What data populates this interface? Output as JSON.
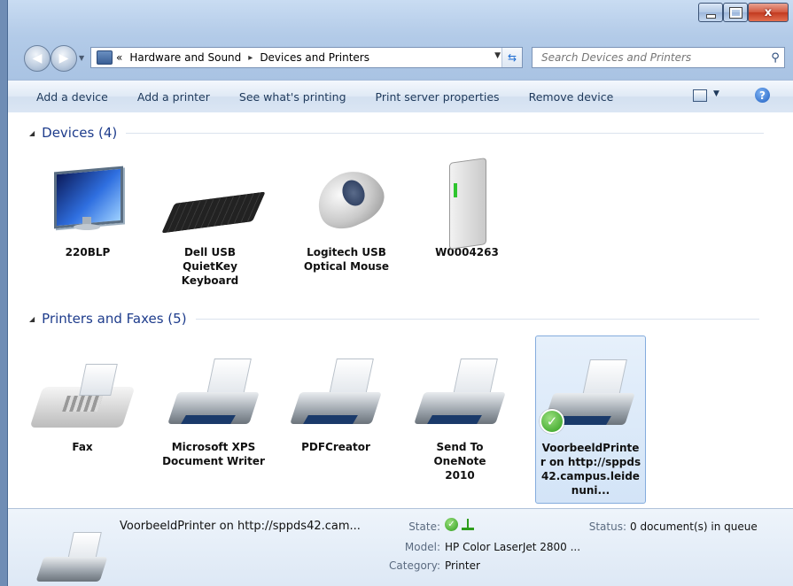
{
  "window": {
    "caption_close": "x"
  },
  "address": {
    "overflow": "«",
    "crumbs": [
      "Hardware and Sound",
      "Devices and Printers"
    ],
    "separator": "▸"
  },
  "search": {
    "placeholder": "Search Devices and Printers"
  },
  "toolbar": {
    "items": [
      "Add a device",
      "Add a printer",
      "See what's printing",
      "Print server properties",
      "Remove device"
    ]
  },
  "groups": {
    "devices": {
      "title": "Devices (4)",
      "items": [
        {
          "label": "220BLP",
          "icon": "monitor-icon"
        },
        {
          "label": "Dell USB QuietKey Keyboard",
          "icon": "keyboard-icon"
        },
        {
          "label": "Logitech USB Optical Mouse",
          "icon": "mouse-icon"
        },
        {
          "label": "W0004263",
          "icon": "computer-tower-icon"
        }
      ]
    },
    "printers": {
      "title": "Printers and Faxes (5)",
      "items": [
        {
          "label": "Fax",
          "icon": "fax-icon"
        },
        {
          "label": "Microsoft XPS Document Writer",
          "icon": "printer-icon"
        },
        {
          "label": "PDFCreator",
          "icon": "printer-icon"
        },
        {
          "label": "Send To OneNote 2010",
          "icon": "printer-icon"
        },
        {
          "label": "VoorbeeldPrinter on http://sppds42.campus.leidenuni...",
          "icon": "printer-icon",
          "default": true
        }
      ]
    }
  },
  "details": {
    "title": "VoorbeeldPrinter on http://sppds42.cam...",
    "state_label": "State:",
    "model_label": "Model:",
    "model_value": "HP Color LaserJet 2800 ...",
    "category_label": "Category:",
    "category_value": "Printer",
    "status_label": "Status:",
    "status_value": "0 document(s) in queue"
  },
  "colors": {
    "accent": "#1e3c8c",
    "selection": "#d3e4f7"
  }
}
